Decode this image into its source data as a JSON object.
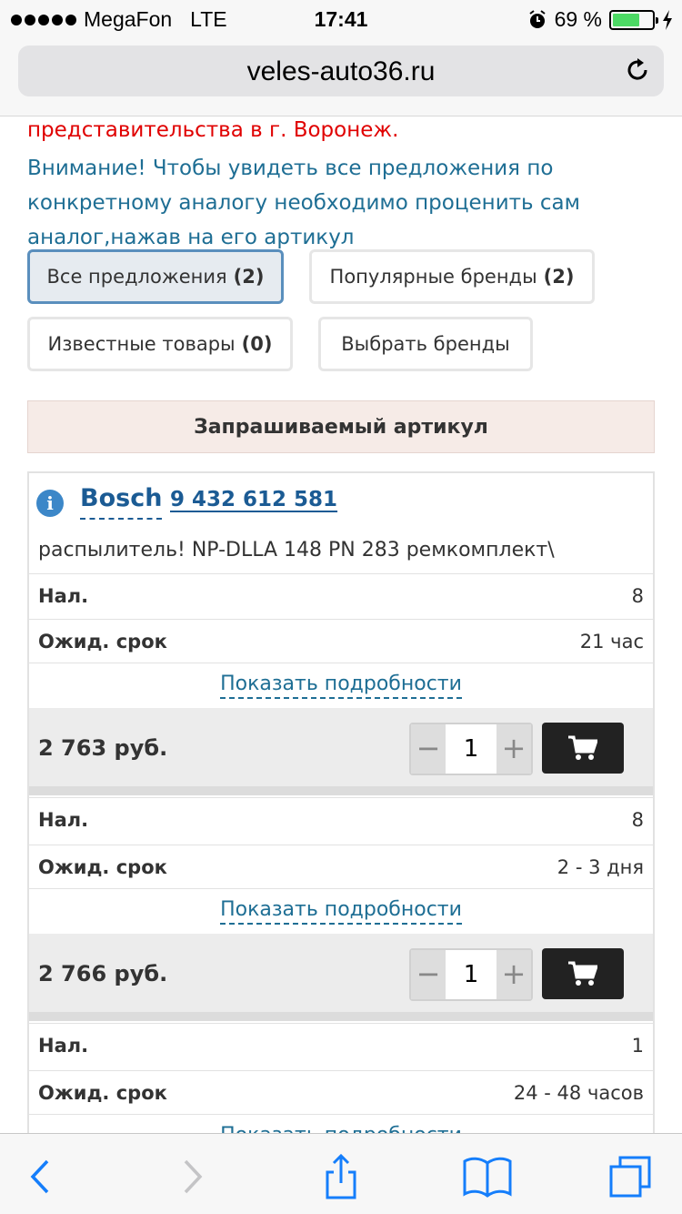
{
  "status_bar": {
    "carrier": "MegaFon",
    "network": "LTE",
    "time": "17:41",
    "battery": "69 %",
    "battery_level": 0.69
  },
  "browser": {
    "url": "veles-auto36.ru"
  },
  "notice": {
    "red_text": "представительства в г. Воронеж.",
    "blue_text": "Внимание! Чтобы увидеть все предложения по конкретному аналогу необходимо проценить сам аналог,нажав на его артикул"
  },
  "filters": [
    {
      "label": "Все предложения",
      "count": "(2)",
      "active": true
    },
    {
      "label": "Популярные бренды",
      "count": "(2)",
      "active": false
    },
    {
      "label": "Известные товары",
      "count": "(0)",
      "active": false
    },
    {
      "label": "Выбрать бренды",
      "count": "",
      "active": false
    }
  ],
  "section_header": "Запрашиваемый артикул",
  "product": {
    "brand": "Bosch",
    "article": "9 432 612 581",
    "description": "распылитель! NP-DLLA 148 PN 283 ремкомплект\\"
  },
  "offers": [
    {
      "availability_label": "Нал.",
      "availability": "8",
      "term_label": "Ожид. срок",
      "term": "21 час",
      "details": "Показать подробности",
      "price": "2 763 руб.",
      "qty": "1"
    },
    {
      "availability_label": "Нал.",
      "availability": "8",
      "term_label": "Ожид. срок",
      "term": "2 - 3 дня",
      "details": "Показать подробности",
      "price": "2 766 руб.",
      "qty": "1"
    },
    {
      "availability_label": "Нал.",
      "availability": "1",
      "term_label": "Ожид. срок",
      "term": "24 - 48 часов",
      "details": "Показать подробности"
    }
  ],
  "stepper": {
    "minus": "−",
    "plus": "+"
  },
  "icons": {
    "info": "info-icon",
    "cart": "cart-icon",
    "reload": "reload-icon",
    "back": "back-icon",
    "forward": "forward-icon",
    "share": "share-icon",
    "bookmarks": "bookmarks-icon",
    "tabs": "tabs-icon"
  },
  "colors": {
    "link": "#1b5b94",
    "notice_red": "#e00000",
    "notice_blue": "#1e6e94",
    "header_bg": "#f6ebe7",
    "cart_bg": "#222222",
    "ios_blue": "#157efb"
  }
}
